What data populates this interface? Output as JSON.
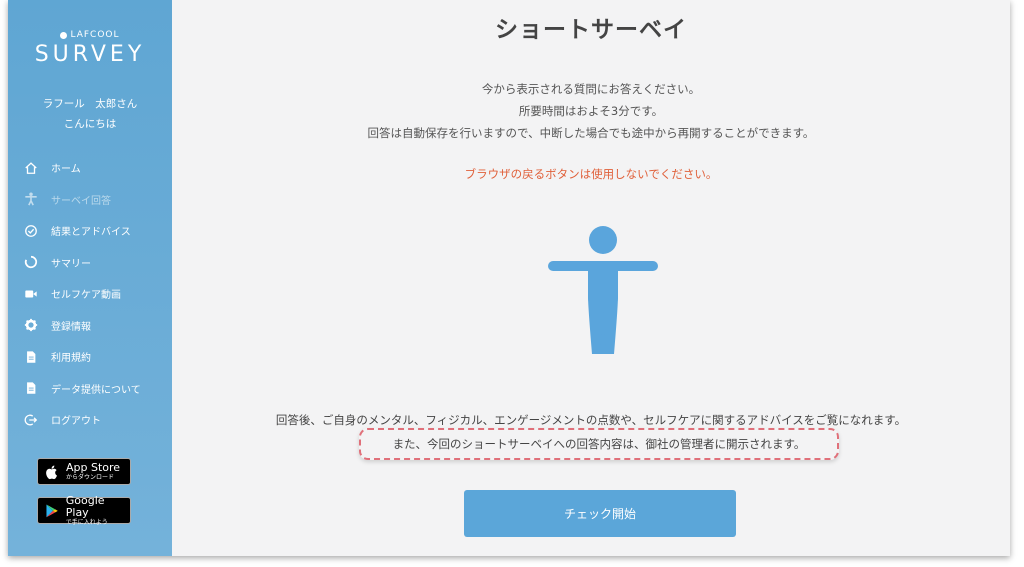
{
  "brand": {
    "top": "LAFCOOL",
    "main": "SURVEY"
  },
  "user": {
    "name": "ラフール　太郎さん",
    "greeting": "こんにちは"
  },
  "nav": [
    {
      "label": "ホーム",
      "icon": "home-icon"
    },
    {
      "label": "サーベイ回答",
      "icon": "person-icon",
      "disabled": true
    },
    {
      "label": "結果とアドバイス",
      "icon": "check-circle-icon"
    },
    {
      "label": "サマリー",
      "icon": "loading-circle-icon"
    },
    {
      "label": "セルフケア動画",
      "icon": "video-icon"
    },
    {
      "label": "登録情報",
      "icon": "gear-icon"
    },
    {
      "label": "利用規約",
      "icon": "document-icon"
    },
    {
      "label": "データ提供について",
      "icon": "document-icon"
    },
    {
      "label": "ログアウト",
      "icon": "logout-icon"
    }
  ],
  "stores": {
    "apple": {
      "big": "App Store",
      "small": "からダウンロード",
      "icon": "apple-icon"
    },
    "google": {
      "big": "Google Play",
      "small": "で手に入れよう",
      "icon": "google-play-icon"
    }
  },
  "main": {
    "title": "ショートサーベイ",
    "intro_lines": [
      "今から表示される質問にお答えください。",
      "所要時間はおよそ3分です。",
      "回答は自動保存を行いますので、中断した場合でも途中から再開することができます。"
    ],
    "warning": "ブラウザの戻るボタンは使用しないでください。",
    "after_text": "回答後、ご自身のメンタル、フィジカル、エンゲージメントの点数や、セルフケアに関するアドバイスをご覧になれます。",
    "notice": "また、今回のショートサーベイへの回答内容は、御社の管理者に開示されます。",
    "start_button": "チェック開始"
  },
  "colors": {
    "sidebar": "#5fa6d3",
    "accent": "#5ba6d9",
    "warning": "#e0603a",
    "figure": "#5aa5dc"
  }
}
